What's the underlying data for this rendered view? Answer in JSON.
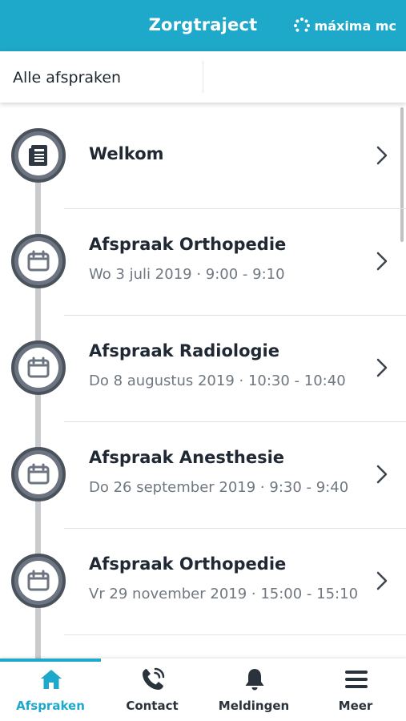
{
  "header": {
    "title": "Zorgtraject",
    "brand": "máxima mc"
  },
  "filter": {
    "label": "Alle afspraken"
  },
  "items": [
    {
      "title": "Welkom",
      "subtitle": "",
      "icon": "document-icon"
    },
    {
      "title": "Afspraak Orthopedie",
      "subtitle": "Wo 3 juli 2019 · 9:00 - 9:10",
      "icon": "calendar-icon"
    },
    {
      "title": "Afspraak Radiologie",
      "subtitle": "Do 8 augustus 2019 · 10:30 - 10:40",
      "icon": "calendar-icon"
    },
    {
      "title": "Afspraak Anesthesie",
      "subtitle": "Do 26 september 2019 · 9:30 - 9:40",
      "icon": "calendar-icon"
    },
    {
      "title": "Afspraak Orthopedie",
      "subtitle": "Vr 29 november 2019 · 15:00 - 15:10",
      "icon": "calendar-icon"
    }
  ],
  "tabs": [
    {
      "label": "Afspraken",
      "icon": "home-icon",
      "active": true
    },
    {
      "label": "Contact",
      "icon": "phone-icon",
      "active": false
    },
    {
      "label": "Meldingen",
      "icon": "bell-icon",
      "active": false
    },
    {
      "label": "Meer",
      "icon": "menu-icon",
      "active": false
    }
  ],
  "colors": {
    "accent": "#1ea8c9",
    "node": "#5b636d",
    "text": "#1f2833",
    "subtext": "#6f7780"
  }
}
